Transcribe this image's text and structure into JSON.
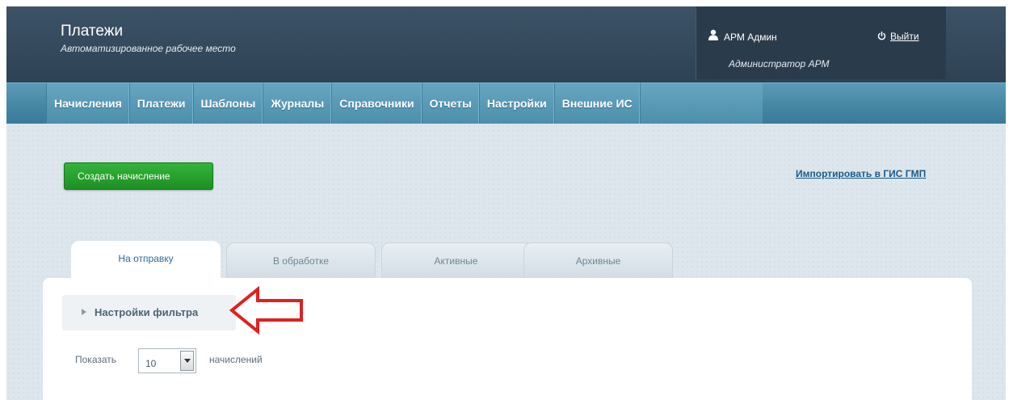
{
  "header": {
    "title": "Платежи",
    "subtitle": "Автоматизированное рабочее место",
    "user_name": "АРМ Админ",
    "user_role": "Администратор АРМ",
    "logout_label": "Выйти",
    "user_icon": "user-icon",
    "logout_icon": "power-icon"
  },
  "nav": {
    "items": [
      {
        "label": "Начисления"
      },
      {
        "label": "Платежи"
      },
      {
        "label": "Шаблоны"
      },
      {
        "label": "Журналы"
      },
      {
        "label": "Справочники"
      },
      {
        "label": "Отчеты"
      },
      {
        "label": "Настройки"
      },
      {
        "label": "Внешние ИС"
      }
    ]
  },
  "toolbar": {
    "create_label": "Создать начисление",
    "import_label": "Импортировать в ГИС ГМП"
  },
  "tabs": [
    {
      "label": "На отправку",
      "active": true
    },
    {
      "label": "В обработке",
      "active": false
    },
    {
      "label": "Активные",
      "active": false
    },
    {
      "label": "Архивные",
      "active": false
    }
  ],
  "filter": {
    "label": "Настройки фильтра"
  },
  "pagination": {
    "show_label": "Показать",
    "page_size": "10",
    "suffix": "начислений"
  },
  "colors": {
    "header_bg": "#2e4254",
    "nav_bg": "#4688a5",
    "create_button": "#1e8f25",
    "annotation_arrow": "#e02020",
    "table_header": "#2f97c2"
  }
}
